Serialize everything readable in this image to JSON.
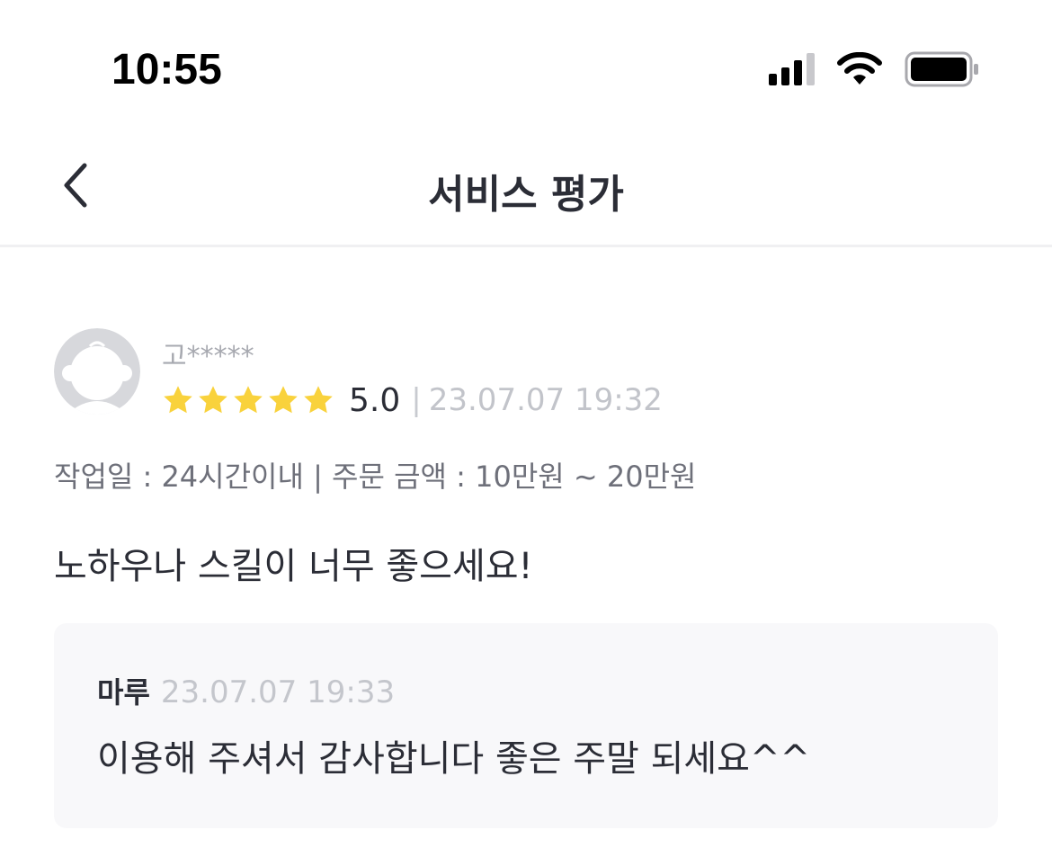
{
  "status_bar": {
    "time": "10:55"
  },
  "header": {
    "title": "서비스 평가",
    "back_icon": "chevron-left-icon"
  },
  "review": {
    "reviewer_name": "고*****",
    "rating": "5.0",
    "rating_stars": 5,
    "rating_max": 5,
    "separator": "|",
    "date": "23.07.07 19:32",
    "meta": "작업일 : 24시간이내 | 주문 금액 : 10만원 ~ 20만원",
    "body": "노하우나 스킬이 너무 좋으세요!"
  },
  "reply": {
    "author": "마루",
    "date": "23.07.07 19:33",
    "body": "이용해 주셔서 감사합니다 좋은 주말 되세요^^"
  },
  "colors": {
    "star": "#f9d23c",
    "text_primary": "#2b2d36",
    "text_muted": "#c2c4ca",
    "reply_bg": "#f8f8fa"
  }
}
